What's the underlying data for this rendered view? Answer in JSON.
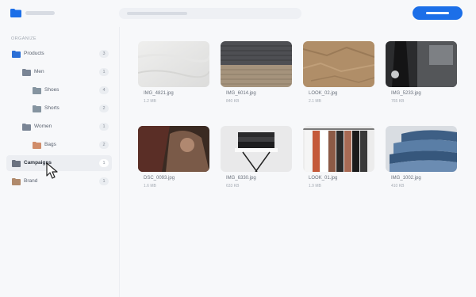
{
  "header": {
    "logo_icon": "folder-icon",
    "accent": "#1c6fe8"
  },
  "sidebar": {
    "section_label": "ORGANIZE",
    "items": [
      {
        "label": "Products",
        "count": "3",
        "icon": "folder-icon",
        "color": "#2b6fd6"
      },
      {
        "label": "Men",
        "count": "1",
        "icon": "folder-icon",
        "color": "#7a8595"
      },
      {
        "label": "Shoes",
        "count": "4",
        "icon": "folder-icon",
        "color": "#8594a0"
      },
      {
        "label": "Shorts",
        "count": "2",
        "icon": "folder-icon",
        "color": "#8594a0"
      },
      {
        "label": "Women",
        "count": "1",
        "icon": "folder-icon",
        "color": "#7a8595"
      },
      {
        "label": "Bags",
        "count": "2",
        "icon": "folder-icon",
        "color": "#d08d6a"
      },
      {
        "label": "Campaigns",
        "count": "1",
        "icon": "folder-icon",
        "color": "#6b7280"
      },
      {
        "label": "Brand",
        "count": "1",
        "icon": "folder-icon",
        "color": "#b08a6c"
      }
    ]
  },
  "files": [
    {
      "name": "IMG_4821.jpg",
      "size": "1.2 MB"
    },
    {
      "name": "IMG_6014.jpg",
      "size": "840 KB"
    },
    {
      "name": "LOOK_02.jpg",
      "size": "2.1 MB"
    },
    {
      "name": "IMG_5233.jpg",
      "size": "765 KB"
    },
    {
      "name": "DSC_0093.jpg",
      "size": "1.6 MB"
    },
    {
      "name": "IMG_6330.jpg",
      "size": "633 KB"
    },
    {
      "name": "LOOK_01.jpg",
      "size": "1.9 MB"
    },
    {
      "name": "IMG_1002.jpg",
      "size": "410 KB"
    }
  ]
}
